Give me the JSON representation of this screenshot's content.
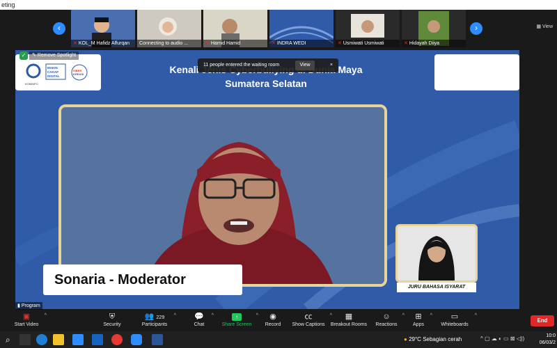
{
  "window": {
    "title": "eting"
  },
  "gallery": {
    "participants": [
      {
        "name": "KOL_M Hafidz Alfurqan",
        "muted": true
      },
      {
        "name": "Connecting to audio ...",
        "muted": false
      },
      {
        "name": "Hamid Hamid",
        "muted": true
      },
      {
        "name": "INDRA WEDI",
        "muted": true
      },
      {
        "name": "Usmiwati Usmiwati",
        "muted": true
      },
      {
        "name": "Hidayah Diiya",
        "muted": true
      }
    ],
    "view_label": "View"
  },
  "slide": {
    "title_line1": "Kenali Jenis Cyberbullying di Dunia Maya",
    "title_line2": "Sumatera Selatan",
    "logos": {
      "org": "KOMINFO",
      "brand1": "MAKIN CAKAP DIGITAL",
      "brand2": "SIBERKREASI"
    },
    "spotlight_label": "Remove Spotlight",
    "waiting_room": {
      "message": "11 people entered the waiting room",
      "view_label": "View",
      "close": "×"
    },
    "speaker_name": "Sonaria - Moderator",
    "interpreter_label": "JURU BAHASA ISYARAT",
    "program_label": "Program"
  },
  "toolbar": {
    "start_video": "Start Video",
    "security": "Security",
    "participants": "Participants",
    "participants_count": "229",
    "chat": "Chat",
    "share_screen": "Share Screen",
    "record": "Record",
    "show_captions": "Show Captions",
    "breakout_rooms": "Breakout Rooms",
    "reactions": "Reactions",
    "apps": "Apps",
    "whiteboards": "Whiteboards",
    "end": "End"
  },
  "taskbar": {
    "temperature": "29°C",
    "weather": "Sebagian cerah",
    "time": "10:0",
    "date": "06/03/2"
  },
  "colors": {
    "accent": "#2d8cff",
    "slide_bg": "#2f5ba8",
    "frame": "#e8d49a",
    "end": "#e02828",
    "share": "#22c55e"
  }
}
